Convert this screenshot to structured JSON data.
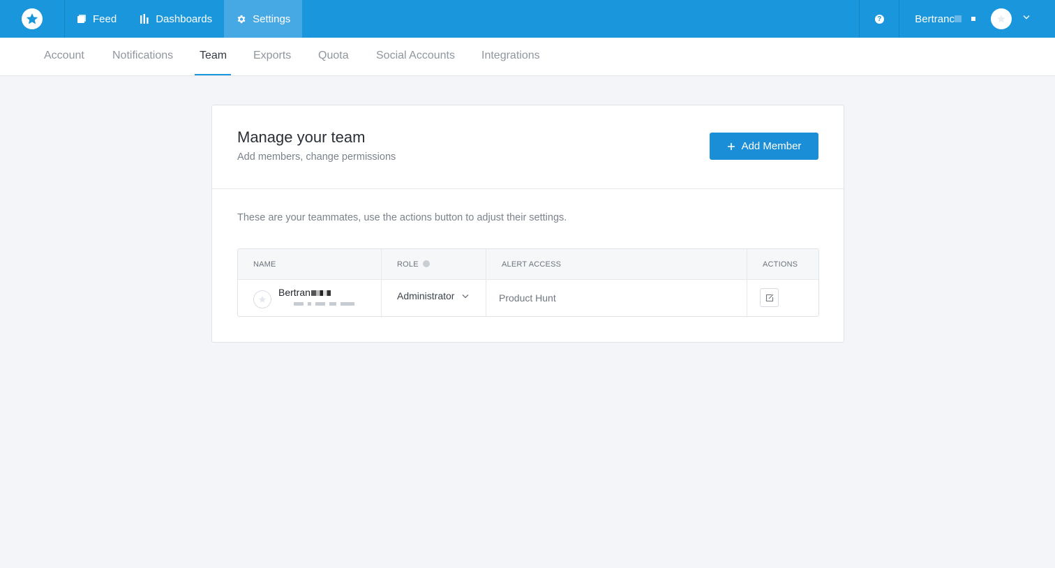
{
  "topbar": {
    "nav": [
      {
        "label": "Feed",
        "icon": "feed-icon"
      },
      {
        "label": "Dashboards",
        "icon": "bar-chart-icon"
      },
      {
        "label": "Settings",
        "icon": "gear-icon",
        "active": true
      }
    ],
    "user_name": "Bertranc",
    "colors": {
      "primary": "#1a96dc",
      "active_tab": "#47a9e4"
    }
  },
  "subnav": {
    "tabs": [
      "Account",
      "Notifications",
      "Team",
      "Exports",
      "Quota",
      "Social Accounts",
      "Integrations"
    ],
    "active": "Team"
  },
  "team": {
    "title": "Manage your team",
    "subtitle": "Add members, change permissions",
    "add_button": "Add Member",
    "description": "These are your teammates, use the actions button to adjust their settings.",
    "columns": [
      "NAME",
      "ROLE",
      "ALERT ACCESS",
      "ACTIONS"
    ],
    "members": [
      {
        "name": "Bertran",
        "role": "Administrator",
        "alert_access": "Product Hunt"
      }
    ]
  }
}
